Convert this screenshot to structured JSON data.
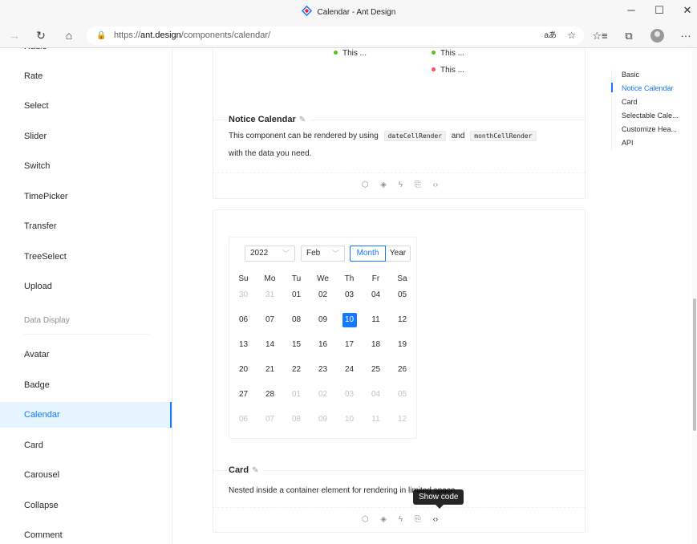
{
  "window": {
    "title": "Calendar - Ant Design",
    "minimize": "─",
    "maximize": "☐",
    "close": "✕"
  },
  "browser": {
    "back": "→",
    "reload": "↻",
    "home": "⌂",
    "url_prefix": "https://",
    "url_host": "ant.design",
    "url_path": "/components/calendar/",
    "lock": "🔒",
    "translate": "aあ",
    "favorite": "☆",
    "favorites_bar": "☆≡",
    "collections": "⧉",
    "more": "···"
  },
  "sidebar": {
    "items": [
      {
        "label": "Radio"
      },
      {
        "label": "Rate"
      },
      {
        "label": "Select"
      },
      {
        "label": "Slider"
      },
      {
        "label": "Switch"
      },
      {
        "label": "TimePicker"
      },
      {
        "label": "Transfer"
      },
      {
        "label": "TreeSelect"
      },
      {
        "label": "Upload"
      }
    ],
    "group": "Data Display",
    "items2": [
      {
        "label": "Avatar"
      },
      {
        "label": "Badge"
      },
      {
        "label": "Calendar"
      },
      {
        "label": "Card"
      },
      {
        "label": "Carousel"
      },
      {
        "label": "Collapse"
      },
      {
        "label": "Comment"
      }
    ]
  },
  "notices": {
    "col1": [
      {
        "text": "This ...",
        "color": "#52c41a"
      }
    ],
    "col2": [
      {
        "text": "This ...",
        "color": "#52c41a"
      },
      {
        "text": "This ...",
        "color": "#ff4d4f"
      }
    ]
  },
  "notice_calendar": {
    "title": "Notice Calendar",
    "desc_before": "This component can be rendered by using",
    "code1": "dateCellRender",
    "desc_and": "and",
    "code2": "monthCellRender",
    "desc_after": "with the data you need."
  },
  "card_demo": {
    "title": "Card",
    "desc": "Nested inside a container element for rendering in limited space.",
    "year": "2022",
    "month": "Feb",
    "mode_month": "Month",
    "mode_year": "Year",
    "weekdays": [
      "Su",
      "Mo",
      "Tu",
      "We",
      "Th",
      "Fr",
      "Sa"
    ],
    "weeks": [
      [
        "30",
        "31",
        "01",
        "02",
        "03",
        "04",
        "05"
      ],
      [
        "06",
        "07",
        "08",
        "09",
        "10",
        "11",
        "12"
      ],
      [
        "13",
        "14",
        "15",
        "16",
        "17",
        "18",
        "19"
      ],
      [
        "20",
        "21",
        "22",
        "23",
        "24",
        "25",
        "26"
      ],
      [
        "27",
        "28",
        "01",
        "02",
        "03",
        "04",
        "05"
      ],
      [
        "06",
        "07",
        "08",
        "09",
        "10",
        "11",
        "12"
      ]
    ],
    "selected": "10"
  },
  "actions": {
    "codesandbox": "⬡",
    "codepen": "◈",
    "stackblitz": "ϟ",
    "copy": "⎘",
    "show_code": "‹›"
  },
  "tooltip": "Show code",
  "anchor": {
    "items": [
      {
        "label": "Basic"
      },
      {
        "label": "Notice Calendar"
      },
      {
        "label": "Card"
      },
      {
        "label": "Selectable Cale..."
      },
      {
        "label": "Customize Hea..."
      },
      {
        "label": "API"
      }
    ]
  },
  "colors": {
    "primary": "#1677ff",
    "success": "#52c41a",
    "error": "#ff4d4f"
  }
}
